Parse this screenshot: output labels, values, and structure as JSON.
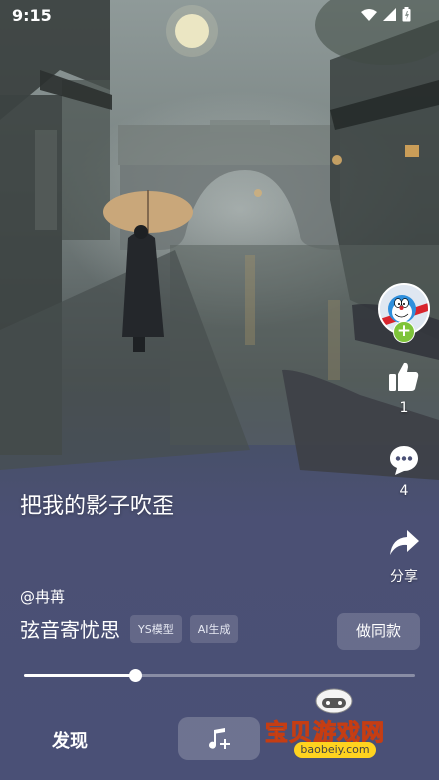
{
  "status_bar": {
    "time": "9:15"
  },
  "video": {
    "title": "把我的影子吹歪"
  },
  "actions": {
    "like_count": "1",
    "comment_count": "4",
    "share_label": "分享"
  },
  "author": "@冉苒",
  "song": {
    "name": "弦音寄忧思",
    "tags": [
      "YS模型",
      "AI生成"
    ],
    "same_button": "做同款"
  },
  "progress": {
    "fraction": 0.285
  },
  "nav": {
    "discover": "发现"
  },
  "watermark": {
    "text": "宝贝游戏网",
    "url": "baobeiy.com"
  },
  "colors": {
    "accent_green": "#7ec43a",
    "background": "#4a5076",
    "watermark_yellow": "#ffd31f"
  }
}
